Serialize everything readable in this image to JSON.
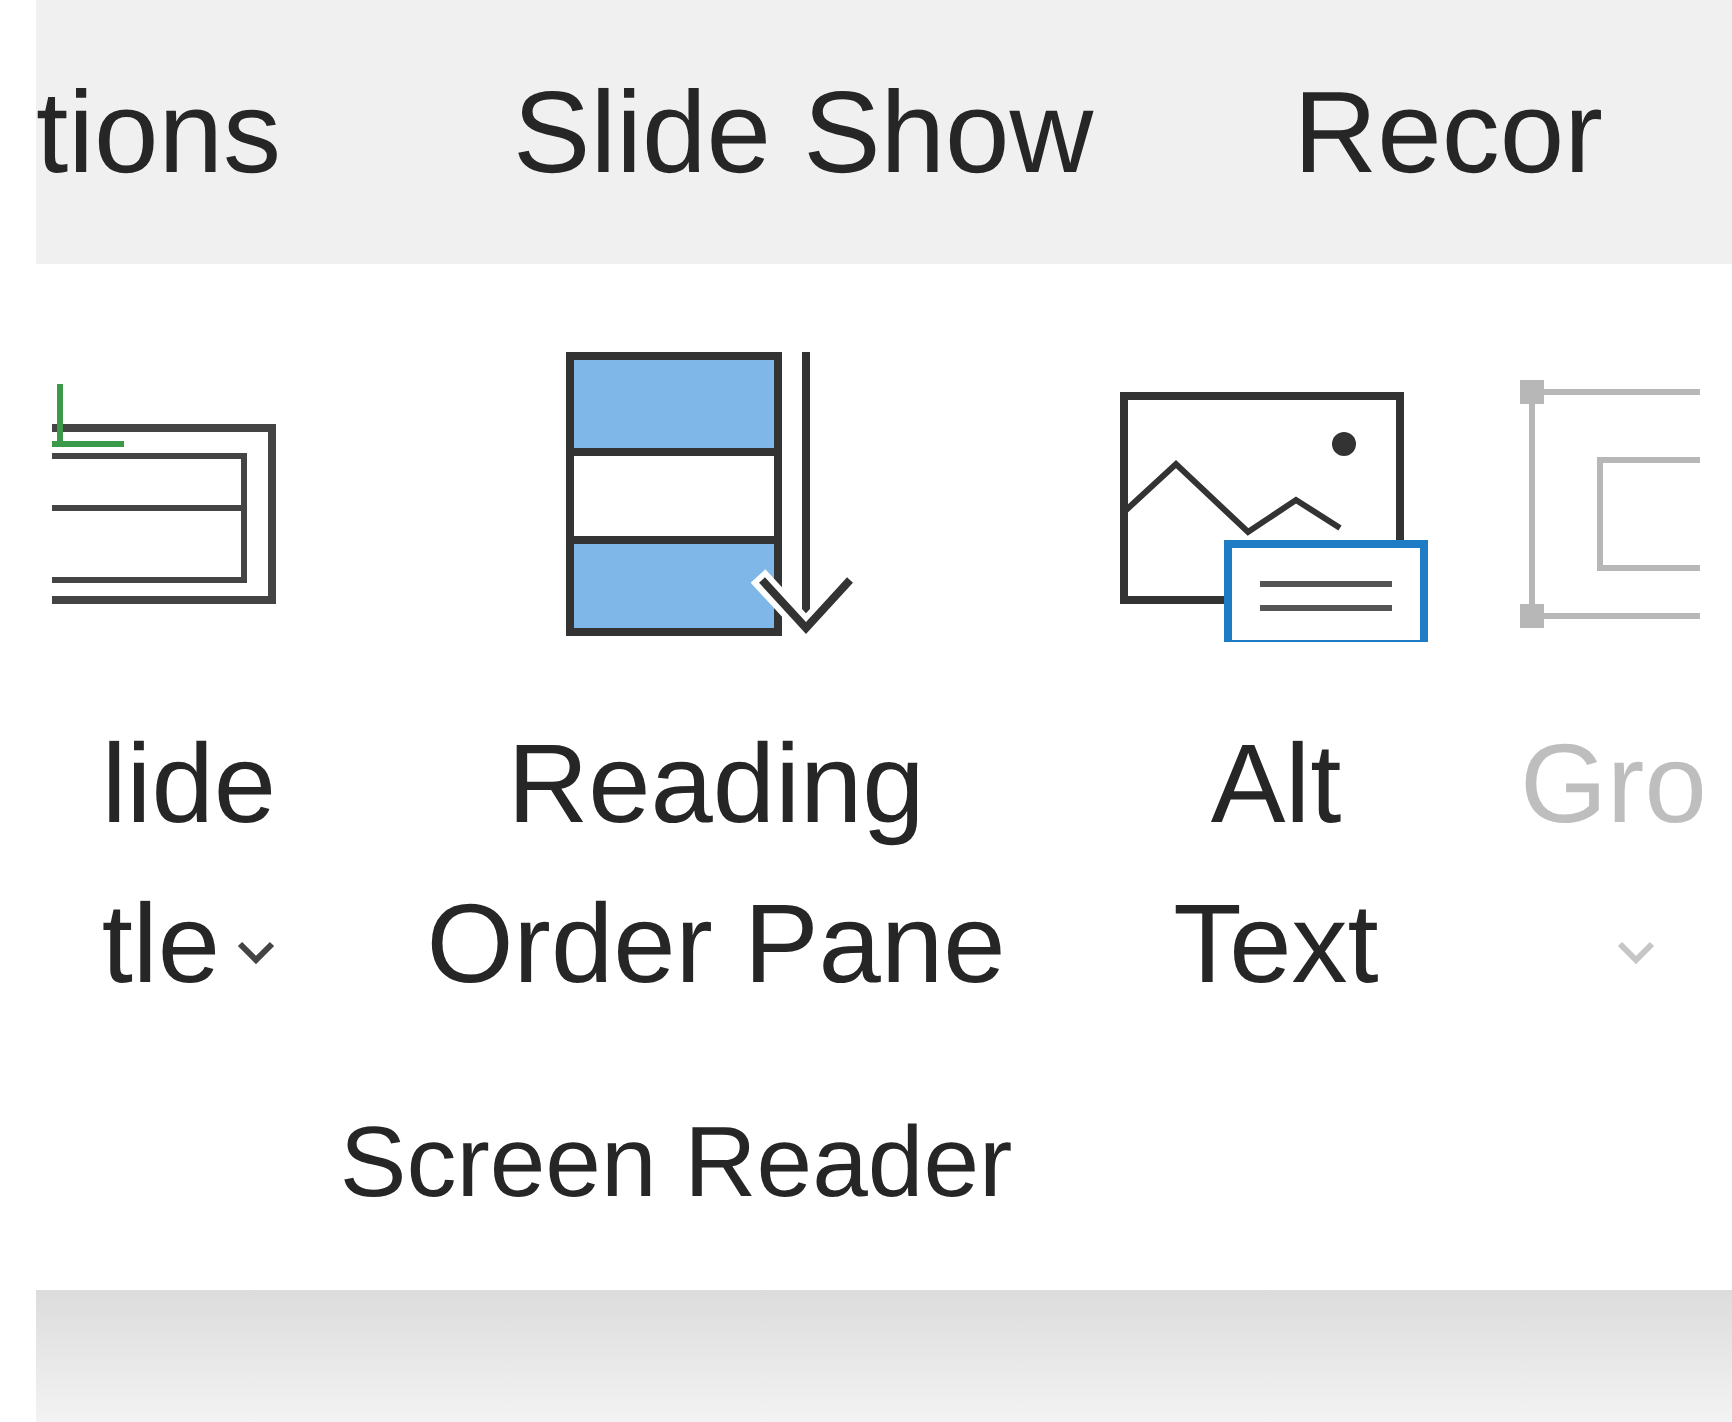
{
  "tabs": [
    {
      "label": "tions"
    },
    {
      "label": "Slide Show"
    },
    {
      "label": "Recor"
    }
  ],
  "ribbon": {
    "buttons": [
      {
        "kind": "slide-title",
        "lines": [
          "lide",
          "tle"
        ],
        "dropdown": true,
        "disabled": false
      },
      {
        "kind": "reading-order",
        "lines": [
          "Reading",
          "Order Pane"
        ],
        "dropdown": false,
        "disabled": false
      },
      {
        "kind": "alt-text",
        "lines": [
          "Alt",
          "Text"
        ],
        "dropdown": false,
        "disabled": false
      },
      {
        "kind": "group",
        "lines": [
          "Gro"
        ],
        "dropdown": true,
        "disabled": true
      }
    ],
    "group_label": "Screen Reader"
  }
}
